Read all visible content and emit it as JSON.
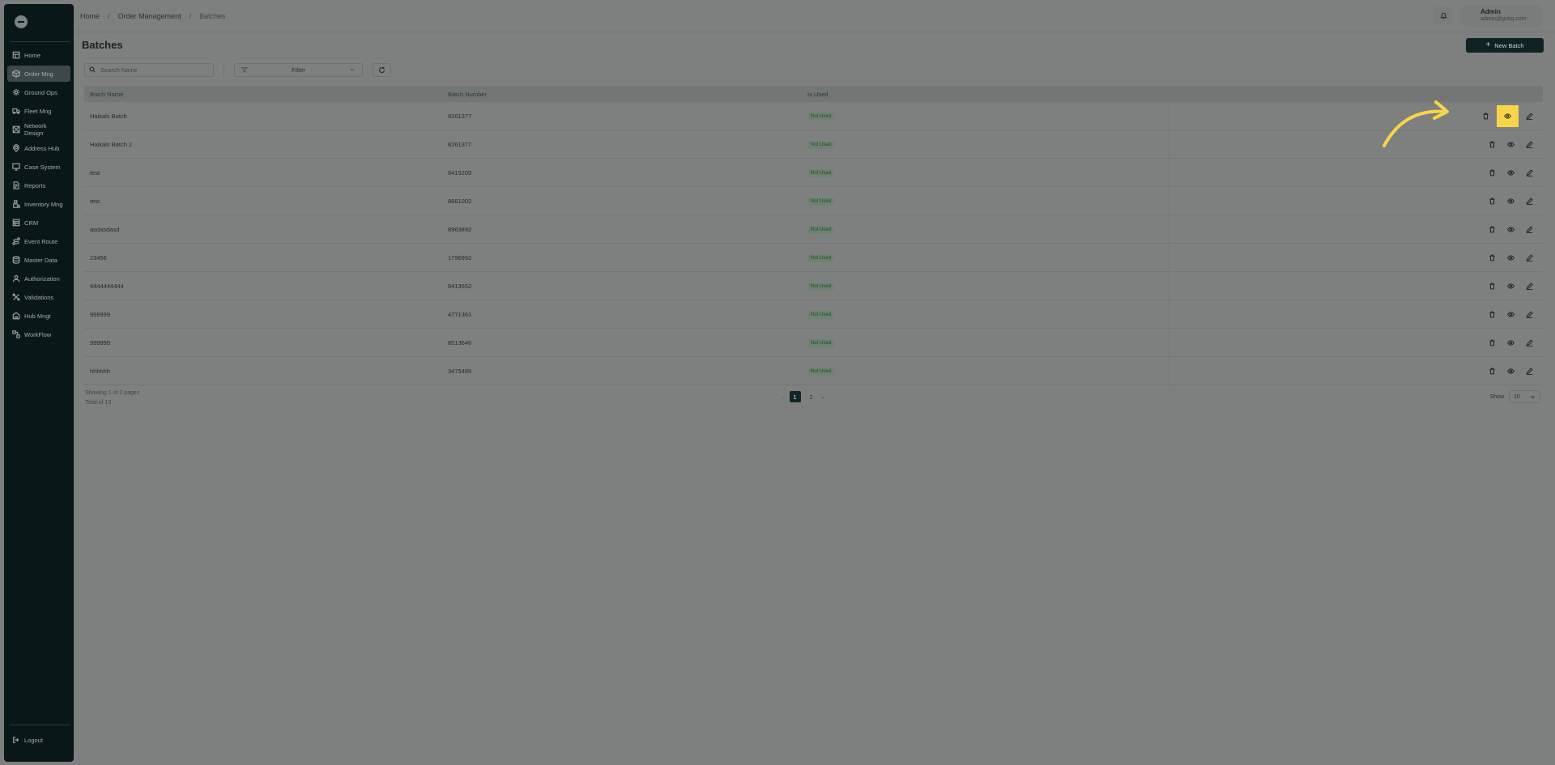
{
  "sidebar": {
    "items": [
      {
        "label": "Home",
        "icon": "layout-icon",
        "active": false
      },
      {
        "label": "Order Mng",
        "icon": "package-icon",
        "active": true
      },
      {
        "label": "Ground Ops",
        "icon": "settings-icon",
        "active": false
      },
      {
        "label": "Fleet Mng",
        "icon": "truck-icon",
        "active": false
      },
      {
        "label": "Network Design",
        "icon": "network-icon",
        "active": false
      },
      {
        "label": "Address Hub",
        "icon": "location-icon",
        "active": false
      },
      {
        "label": "Case System",
        "icon": "monitor-icon",
        "active": false
      },
      {
        "label": "Reports",
        "icon": "report-icon",
        "active": false
      },
      {
        "label": "Inventory Mng",
        "icon": "inventory-icon",
        "active": false
      },
      {
        "label": "CRM",
        "icon": "crm-icon",
        "active": false
      },
      {
        "label": "Event Route",
        "icon": "route-icon",
        "active": false
      },
      {
        "label": "Master Data",
        "icon": "database-icon",
        "active": false
      },
      {
        "label": "Authorization",
        "icon": "user-icon",
        "active": false
      },
      {
        "label": "Validations",
        "icon": "validation-icon",
        "active": false
      },
      {
        "label": "Hub Mngt",
        "icon": "hub-icon",
        "active": false
      },
      {
        "label": "WorkFlow",
        "icon": "workflow-icon",
        "active": false
      }
    ],
    "logout_label": "Logout"
  },
  "breadcrumb": {
    "home": "Home",
    "section": "Order Management",
    "current": "Batches"
  },
  "user": {
    "name": "Admin",
    "email": "admin@gntiq.com"
  },
  "page": {
    "title": "Batches",
    "new_button": "New Batch"
  },
  "toolbar": {
    "search_placeholder": "Search Name",
    "filter_label": "Filter"
  },
  "table": {
    "headers": [
      "Batch Name",
      "Batch Number",
      "Is Used"
    ],
    "rows": [
      {
        "name": "Haikals Batch",
        "number": "8261377",
        "status": "Not Used"
      },
      {
        "name": "Haikals Batch 2",
        "number": "8261377",
        "status": "Not Used"
      },
      {
        "name": "test",
        "number": "8415209",
        "status": "Not Used"
      },
      {
        "name": "test",
        "number": "8661002",
        "status": "Not Used"
      },
      {
        "name": "asdasdasd",
        "number": "8963892",
        "status": "Not Used"
      },
      {
        "name": "23456",
        "number": "1796992",
        "status": "Not Used"
      },
      {
        "name": "4444444444",
        "number": "8413652",
        "status": "Not Used"
      },
      {
        "name": "999999",
        "number": "4771361",
        "status": "Not Used"
      },
      {
        "name": "999999",
        "number": "8513646",
        "status": "Not Used"
      },
      {
        "name": "hhhhhh",
        "number": "3475489",
        "status": "Not Used"
      }
    ]
  },
  "pagination": {
    "showing": "Showing 1 of 2 pages",
    "total": "Total of 13",
    "pages": [
      "1",
      "2"
    ],
    "current": "1",
    "show_label": "Show",
    "page_size": "10"
  },
  "colors": {
    "highlight": "#f7d54a",
    "sidebar_bg": "#0a1718",
    "primary_button": "#0f2325"
  }
}
